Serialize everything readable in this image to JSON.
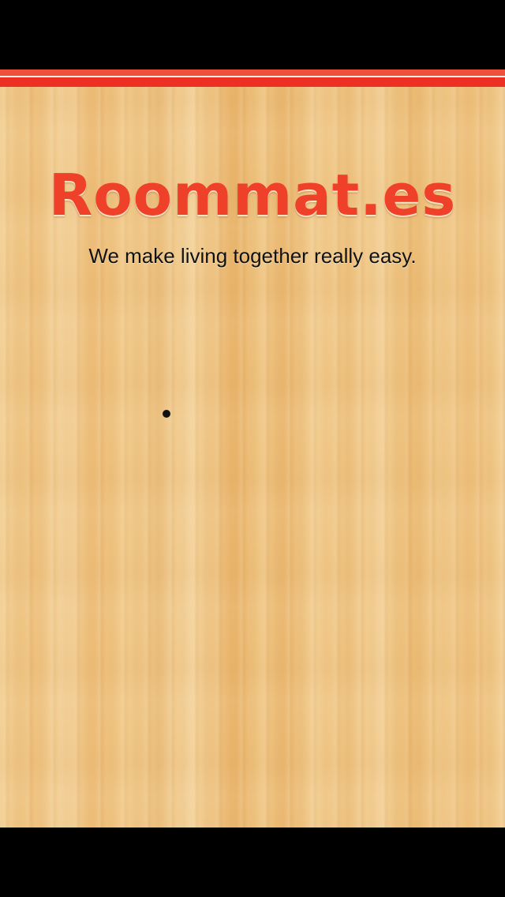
{
  "app": {
    "logo_text": "Roommat.es",
    "tagline": "We make living together really easy."
  },
  "colors": {
    "brand_red": "#ef4129",
    "wood_base": "#efc07a",
    "bars": "#000000"
  }
}
